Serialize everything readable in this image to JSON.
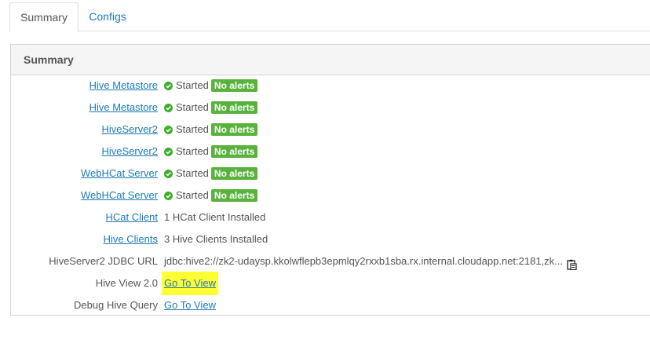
{
  "tabs": [
    {
      "label": "Summary",
      "active": true
    },
    {
      "label": "Configs",
      "active": false
    }
  ],
  "panel": {
    "title": "Summary"
  },
  "rows": [
    {
      "label": "Hive Metastore",
      "status": "Started",
      "badge": "No alerts"
    },
    {
      "label": "Hive Metastore",
      "status": "Started",
      "badge": "No alerts"
    },
    {
      "label": "HiveServer2",
      "status": "Started",
      "badge": "No alerts"
    },
    {
      "label": "HiveServer2",
      "status": "Started",
      "badge": "No alerts"
    },
    {
      "label": "WebHCat Server",
      "status": "Started",
      "badge": "No alerts"
    },
    {
      "label": "WebHCat Server",
      "status": "Started",
      "badge": "No alerts"
    },
    {
      "label": "HCat Client",
      "value": "1 HCat Client Installed"
    },
    {
      "label": "Hive Clients",
      "value": "3 Hive Clients Installed"
    },
    {
      "label": "HiveServer2 JDBC URL",
      "value": "jdbc:hive2://zk2-udaysp.kkolwflepb3epmlqy2rxxb1sba.rx.internal.cloudapp.net:2181,zk..."
    },
    {
      "label": "Hive View 2.0",
      "link": "Go To View"
    },
    {
      "label": "Debug Hive Query",
      "link": "Go To View"
    }
  ],
  "colors": {
    "link": "#1f7ab8",
    "badge": "#58b33c",
    "highlight": "#ffff33"
  }
}
